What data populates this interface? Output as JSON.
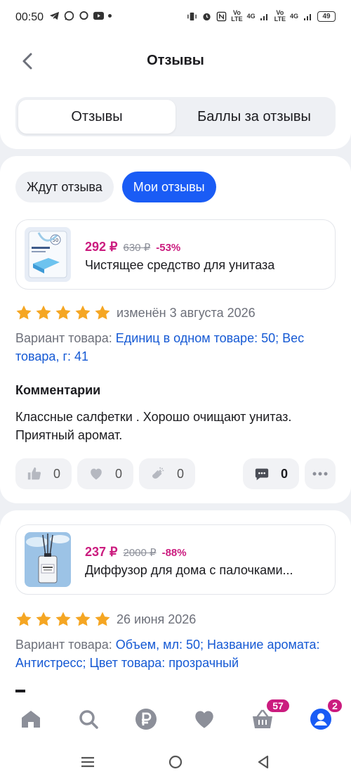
{
  "status_bar": {
    "time": "00:50",
    "battery": "49",
    "sig1": "Vo\nLTE",
    "sig2": "4G",
    "sig3": "Vo\nLTE",
    "sig4": "4G"
  },
  "header": {
    "title": "Отзывы"
  },
  "tabs": [
    {
      "label": "Отзывы",
      "active": true
    },
    {
      "label": "Баллы за отзывы",
      "active": false
    }
  ],
  "filters": [
    {
      "label": "Ждут отзыва",
      "active": false
    },
    {
      "label": "Мои отзывы",
      "active": true
    }
  ],
  "reviews": [
    {
      "product": {
        "price": "292 ₽",
        "old_price": "630 ₽",
        "discount": "-53%",
        "name": "Чистящее средство для унитаза",
        "image_icon": "cleaning-strips-package"
      },
      "rating": 5,
      "date": "изменён 3 августа 2026",
      "variant_label": "Вариант товара:",
      "variant_value": "Единиц в одном товаре: 50; Вес товара, г: 41",
      "comment_title": "Комментарии",
      "comment": "Классные салфетки . Хорошо очищают  унитаз. Приятный аромат.",
      "likes": "0",
      "hearts": "0",
      "claps": "0",
      "comments": "0"
    },
    {
      "product": {
        "price": "237 ₽",
        "old_price": "2000 ₽",
        "discount": "-88%",
        "name": "Диффузор для дома с палочками...",
        "image_icon": "reed-diffuser-bottle"
      },
      "rating": 5,
      "date": "26 июня 2026",
      "variant_label": "Вариант товара:",
      "variant_value": "Объем, мл: 50; Название аромата: Антистресс; Цвет товара: прозрачный"
    }
  ],
  "bottom_nav": {
    "cart_badge": "57",
    "profile_badge": "2",
    "items": [
      "home-icon",
      "search-icon",
      "ruble-icon",
      "heart-icon",
      "basket-icon",
      "profile-icon"
    ]
  },
  "colors": {
    "accent": "#1a5cf5",
    "price": "#cb1c7f",
    "star": "#f5a623",
    "link": "#1559d4"
  }
}
